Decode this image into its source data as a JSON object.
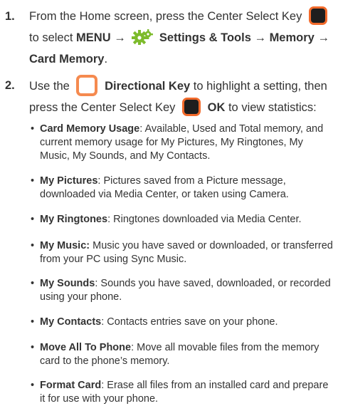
{
  "steps": [
    {
      "number": "1.",
      "line1_text": "From the Home screen, press the Center Select Key",
      "line2_pre": "to select",
      "menu": "MENU",
      "arrow": "→",
      "settings_tools": "Settings & Tools",
      "memory": "Memory",
      "card_memory": "Card Memory",
      "period": "."
    },
    {
      "number": "2.",
      "use_the": "Use the",
      "directional_key": "Directional Key",
      "highlight_text": "to highlight a setting, then",
      "press_text": "press the Center Select Key",
      "ok": "OK",
      "to_view": "to view statistics:"
    }
  ],
  "bullet_char": "•",
  "bullets": [
    {
      "term": "Card Memory Usage",
      "sep": ":",
      "desc": "Available, Used and Total memory, and current memory usage for My Pictures, My Ringtones, My Music, My Sounds, and My Contacts."
    },
    {
      "term": "My Pictures",
      "sep": ":",
      "desc": "Pictures saved from a Picture message, downloaded via Media Center, or taken using Camera."
    },
    {
      "term": "My Ringtones",
      "sep": ":",
      "desc": "Ringtones downloaded via Media Center."
    },
    {
      "term": "My Music:",
      "sep": "",
      "desc": "Music you have saved or downloaded, or transferred from your PC using Sync Music."
    },
    {
      "term": "My Sounds",
      "sep": ":",
      "desc": "Sounds you have saved, downloaded, or recorded using your phone."
    },
    {
      "term": "My Contacts",
      "sep": ":",
      "desc": "Contacts entries save on your phone."
    },
    {
      "term": "Move All To Phone",
      "sep": ":",
      "desc": "Move all movable files from the memory card to the phone’s memory."
    },
    {
      "term": "Format Card",
      "sep": ":",
      "desc": "Erase all files from an installed card and prepare it for use with your phone."
    }
  ],
  "colors": {
    "text": "#333333",
    "key_outline": "#f26a2b",
    "key_fill": "#1e1e1e",
    "gear": "#7dbb2c"
  },
  "icons": [
    "center-select-key-icon",
    "settings-gear-icon",
    "directional-key-icon"
  ]
}
